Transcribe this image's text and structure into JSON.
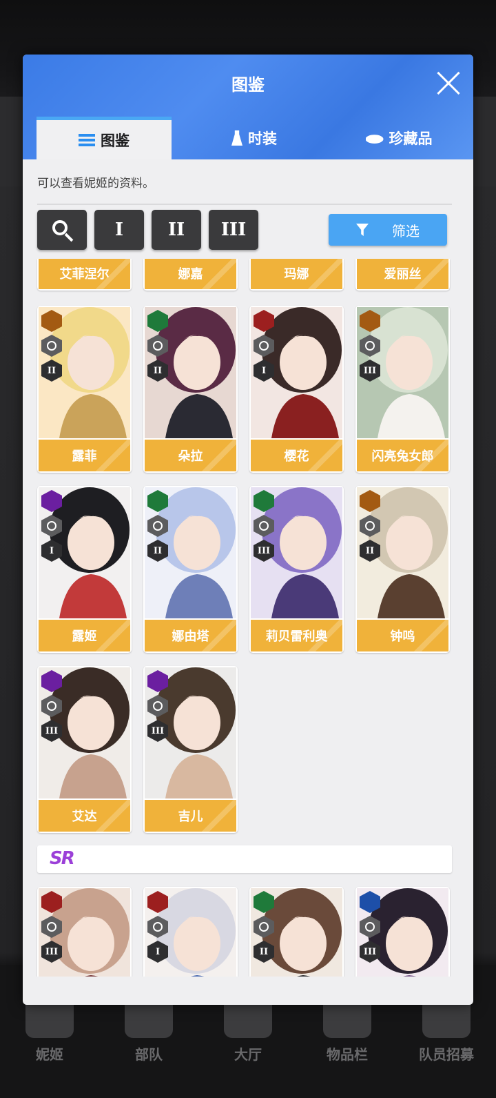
{
  "modal": {
    "title": "图鉴",
    "tabs": [
      {
        "label": "图鉴",
        "icon": "list-icon",
        "active": true
      },
      {
        "label": "时装",
        "icon": "dress-icon",
        "active": false
      },
      {
        "label": "珍藏品",
        "icon": "hat-icon",
        "active": false
      }
    ],
    "description": "可以查看妮姬的资料。",
    "burst_filters": [
      "I",
      "II",
      "III"
    ],
    "filter_label": "筛选",
    "accent_color": "#4aa5f3",
    "card_color": "#f0b23a"
  },
  "partial_row": [
    {
      "name": "艾菲涅尔"
    },
    {
      "name": "娜嘉"
    },
    {
      "name": "玛娜"
    },
    {
      "name": "爱丽丝"
    }
  ],
  "ssr_cards": [
    {
      "name": "露菲",
      "element": "iron",
      "burst": "II",
      "palette": [
        "#f1d98a",
        "#caa35a",
        "#fbe7c4"
      ]
    },
    {
      "name": "朵拉",
      "element": "wind",
      "burst": "II",
      "palette": [
        "#5a2b45",
        "#2a2a33",
        "#e7d8d2"
      ]
    },
    {
      "name": "樱花",
      "element": "fire",
      "burst": "I",
      "palette": [
        "#3a2a28",
        "#8a2020",
        "#f2e6e2"
      ]
    },
    {
      "name": "闪亮兔女郎",
      "element": "iron",
      "burst": "III",
      "palette": [
        "#d8e2d2",
        "#f4f2ee",
        "#b6c7b2"
      ]
    },
    {
      "name": "露姬",
      "element": "electric",
      "burst": "I",
      "palette": [
        "#1e1e22",
        "#c23a3a",
        "#f2f0f0"
      ]
    },
    {
      "name": "娜由塔",
      "element": "wind",
      "burst": "II",
      "palette": [
        "#b8c6ea",
        "#6e7fb8",
        "#eef0f8"
      ]
    },
    {
      "name": "莉贝雷利奥",
      "element": "wind",
      "burst": "III",
      "palette": [
        "#8a74c8",
        "#4a3a78",
        "#e6e0f2"
      ]
    },
    {
      "name": "钟鸣",
      "element": "iron",
      "burst": "II",
      "palette": [
        "#d2c7b2",
        "#5a4030",
        "#f2ecde"
      ]
    },
    {
      "name": "艾达",
      "element": "electric",
      "burst": "III",
      "palette": [
        "#3a2c26",
        "#c7a28e",
        "#f0ece8"
      ]
    },
    {
      "name": "吉儿",
      "element": "electric",
      "burst": "III",
      "palette": [
        "#4a3a2e",
        "#d8b8a0",
        "#ecebea"
      ]
    }
  ],
  "sr_section_label": "SR",
  "sr_cards": [
    {
      "element": "fire",
      "burst": "III",
      "palette": [
        "#c8a28e",
        "#7a3a3a",
        "#f0e4dc"
      ]
    },
    {
      "element": "fire",
      "burst": "I",
      "palette": [
        "#d8d8e2",
        "#4a6ab0",
        "#f4f0ee"
      ]
    },
    {
      "element": "wind",
      "burst": "II",
      "palette": [
        "#6a4a3a",
        "#2a2a2e",
        "#f0e8e0"
      ]
    },
    {
      "element": "water",
      "burst": "III",
      "palette": [
        "#2a2230",
        "#7a5a8a",
        "#f2eaf0"
      ]
    }
  ],
  "bottom_nav": [
    {
      "label": "妮姬"
    },
    {
      "label": "部队"
    },
    {
      "label": "大厅"
    },
    {
      "label": "物品栏"
    },
    {
      "label": "队员招募"
    }
  ]
}
